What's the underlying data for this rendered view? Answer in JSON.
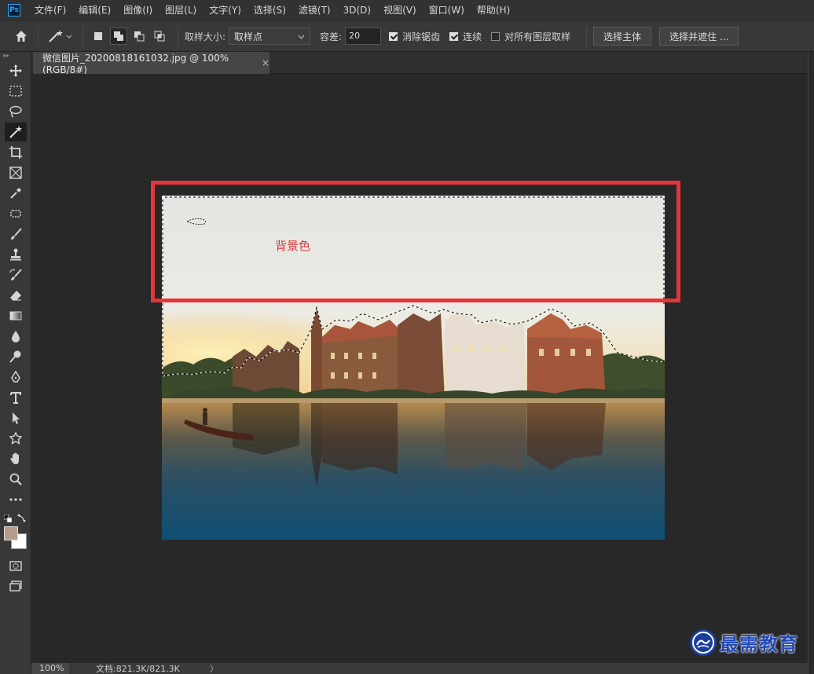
{
  "app": {
    "logo": "Ps"
  },
  "menu": [
    "文件(F)",
    "编辑(E)",
    "图像(I)",
    "图层(L)",
    "文字(Y)",
    "选择(S)",
    "滤镜(T)",
    "3D(D)",
    "视图(V)",
    "窗口(W)",
    "帮助(H)"
  ],
  "options": {
    "sample_size_label": "取样大小:",
    "sample_size_value": "取样点",
    "tolerance_label": "容差:",
    "tolerance_value": "20",
    "antialias_label": "消除锯齿",
    "antialias_checked": true,
    "contiguous_label": "连续",
    "contiguous_checked": true,
    "sample_all_label": "对所有图层取样",
    "sample_all_checked": false,
    "select_subject_label": "选择主体",
    "select_mask_label": "选择并遮住 ..."
  },
  "document": {
    "tab_title": "微信图片_20200818161032.jpg @ 100%(RGB/8#)",
    "close_glyph": "×"
  },
  "annotation": {
    "label": "背景色",
    "color": "#e5353a"
  },
  "status": {
    "zoom": "100%",
    "doc_info": "文档:821.3K/821.3K",
    "arrow": "〉"
  },
  "watermark": {
    "text": "最需教育"
  },
  "colors": {
    "foreground": "#b59d8a",
    "background": "#ffffff"
  },
  "tools": [
    "move-icon",
    "marquee-icon",
    "lasso-icon",
    "magic-wand-icon",
    "crop-icon",
    "frame-icon",
    "eyedropper-icon",
    "patch-icon",
    "brush-icon",
    "stamp-icon",
    "history-brush-icon",
    "eraser-icon",
    "gradient-icon",
    "blur-icon",
    "dodge-icon",
    "pen-icon",
    "type-icon",
    "path-select-icon",
    "shape-icon",
    "hand-icon",
    "zoom-icon",
    "more-icon"
  ]
}
